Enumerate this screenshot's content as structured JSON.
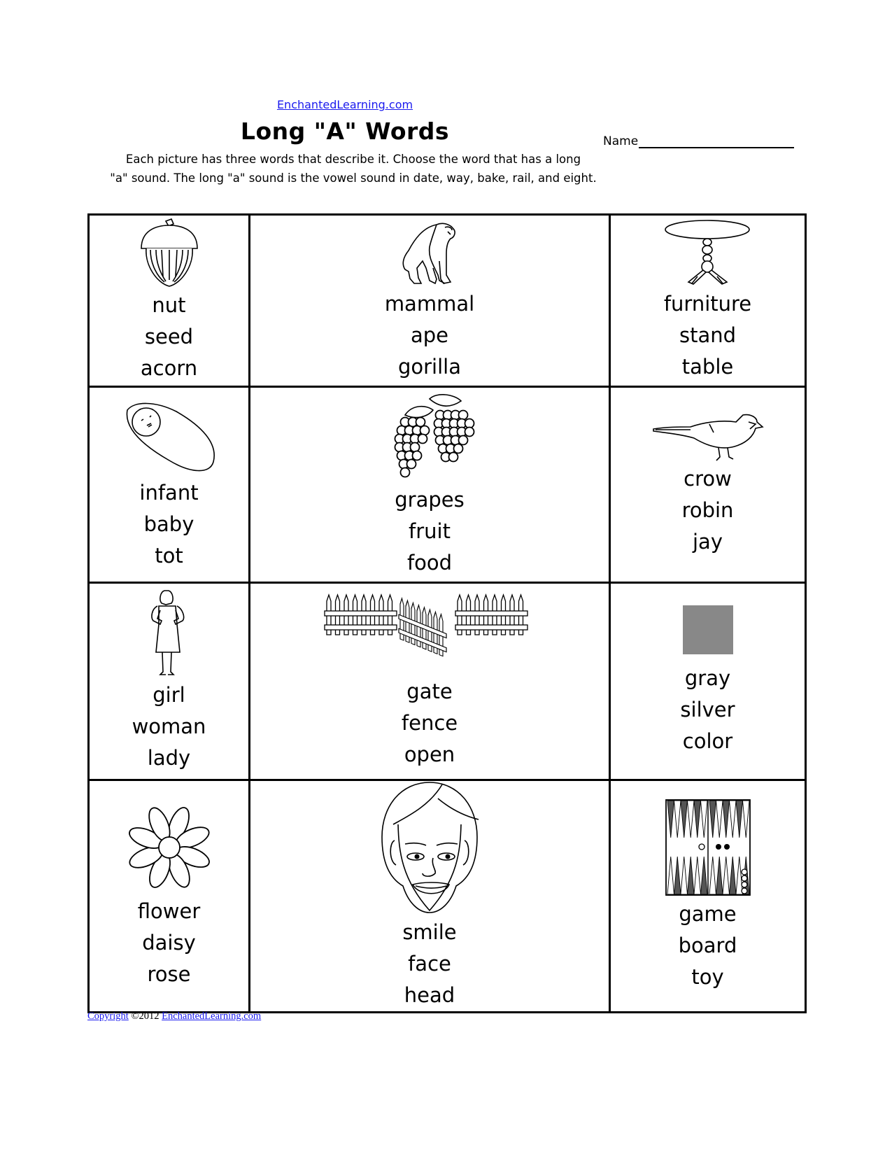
{
  "header": {
    "site_link": "EnchantedLearning.com",
    "title": "Long \"A\" Words",
    "name_label": "Name",
    "instructions_line1": "Each picture has three words that describe it. Choose the word that has a long",
    "instructions_line2": "\"a\" sound. The long \"a\" sound is the vowel sound in date, way, bake, rail, and eight."
  },
  "grid": {
    "rows": [
      [
        {
          "picture": "acorn-icon",
          "words": [
            "nut",
            "seed",
            "acorn"
          ]
        },
        {
          "picture": "gorilla-icon",
          "words": [
            "mammal",
            "ape",
            "gorilla"
          ]
        },
        {
          "picture": "table-icon",
          "words": [
            "furniture",
            "stand",
            "table"
          ]
        }
      ],
      [
        {
          "picture": "baby-icon",
          "words": [
            "infant",
            "baby",
            "tot"
          ]
        },
        {
          "picture": "grapes-icon",
          "words": [
            "grapes",
            "fruit",
            "food"
          ]
        },
        {
          "picture": "bird-icon",
          "words": [
            "crow",
            "robin",
            "jay"
          ]
        }
      ],
      [
        {
          "picture": "woman-icon",
          "words": [
            "girl",
            "woman",
            "lady"
          ]
        },
        {
          "picture": "fence-gate-icon",
          "words": [
            "gate",
            "fence",
            "open"
          ]
        },
        {
          "picture": "gray-square-icon",
          "words": [
            "gray",
            "silver",
            "color"
          ],
          "swatch_color": "#888888"
        }
      ],
      [
        {
          "picture": "daisy-icon",
          "words": [
            "flower",
            "daisy",
            "rose"
          ]
        },
        {
          "picture": "face-icon",
          "words": [
            "smile",
            "face",
            "head"
          ]
        },
        {
          "picture": "backgammon-icon",
          "words": [
            "game",
            "board",
            "toy"
          ]
        }
      ]
    ]
  },
  "footer": {
    "copyright_link": "Copyright",
    "year_text": "©2012",
    "site_link": "EnchantedLearning.com"
  },
  "colors": {
    "link": "#1a1aee",
    "gray_swatch": "#888888"
  }
}
